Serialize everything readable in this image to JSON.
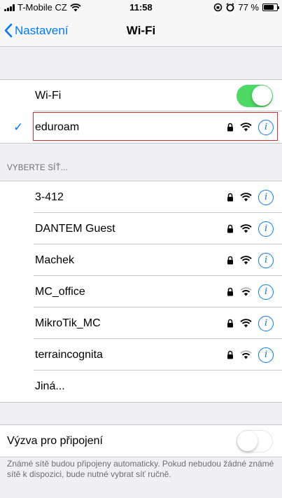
{
  "status_bar": {
    "carrier": "T-Mobile CZ",
    "time": "11:58",
    "battery": "77 %",
    "battery_level": 0.77
  },
  "nav": {
    "back_label": "Nastavení",
    "title": "Wi-Fi"
  },
  "wifi_toggle": {
    "label": "Wi-Fi",
    "enabled": true
  },
  "connected_network": {
    "name": "eduroam",
    "secured": true
  },
  "networks_header": "VYBERTE SÍŤ...",
  "networks": [
    {
      "name": "3-412",
      "secured": true,
      "signal": "full"
    },
    {
      "name": "DANTEM Guest",
      "secured": true,
      "signal": "full"
    },
    {
      "name": "Machek",
      "secured": true,
      "signal": "full"
    },
    {
      "name": "MC_office",
      "secured": true,
      "signal": "weak"
    },
    {
      "name": "MikroTik_MC",
      "secured": true,
      "signal": "full"
    },
    {
      "name": "terraincognita",
      "secured": true,
      "signal": "weak"
    }
  ],
  "other_label": "Jiná...",
  "ask_join": {
    "label": "Výzva pro připojení",
    "enabled": false
  },
  "footer_text": "Známé sítě budou připojeny automaticky. Pokud nebudou žádné známé sítě k dispozici, bude nutné vybrat síť ručně.",
  "colors": {
    "accent": "#007aff",
    "toggle_on": "#4cd964",
    "highlight": "#d0302f"
  }
}
